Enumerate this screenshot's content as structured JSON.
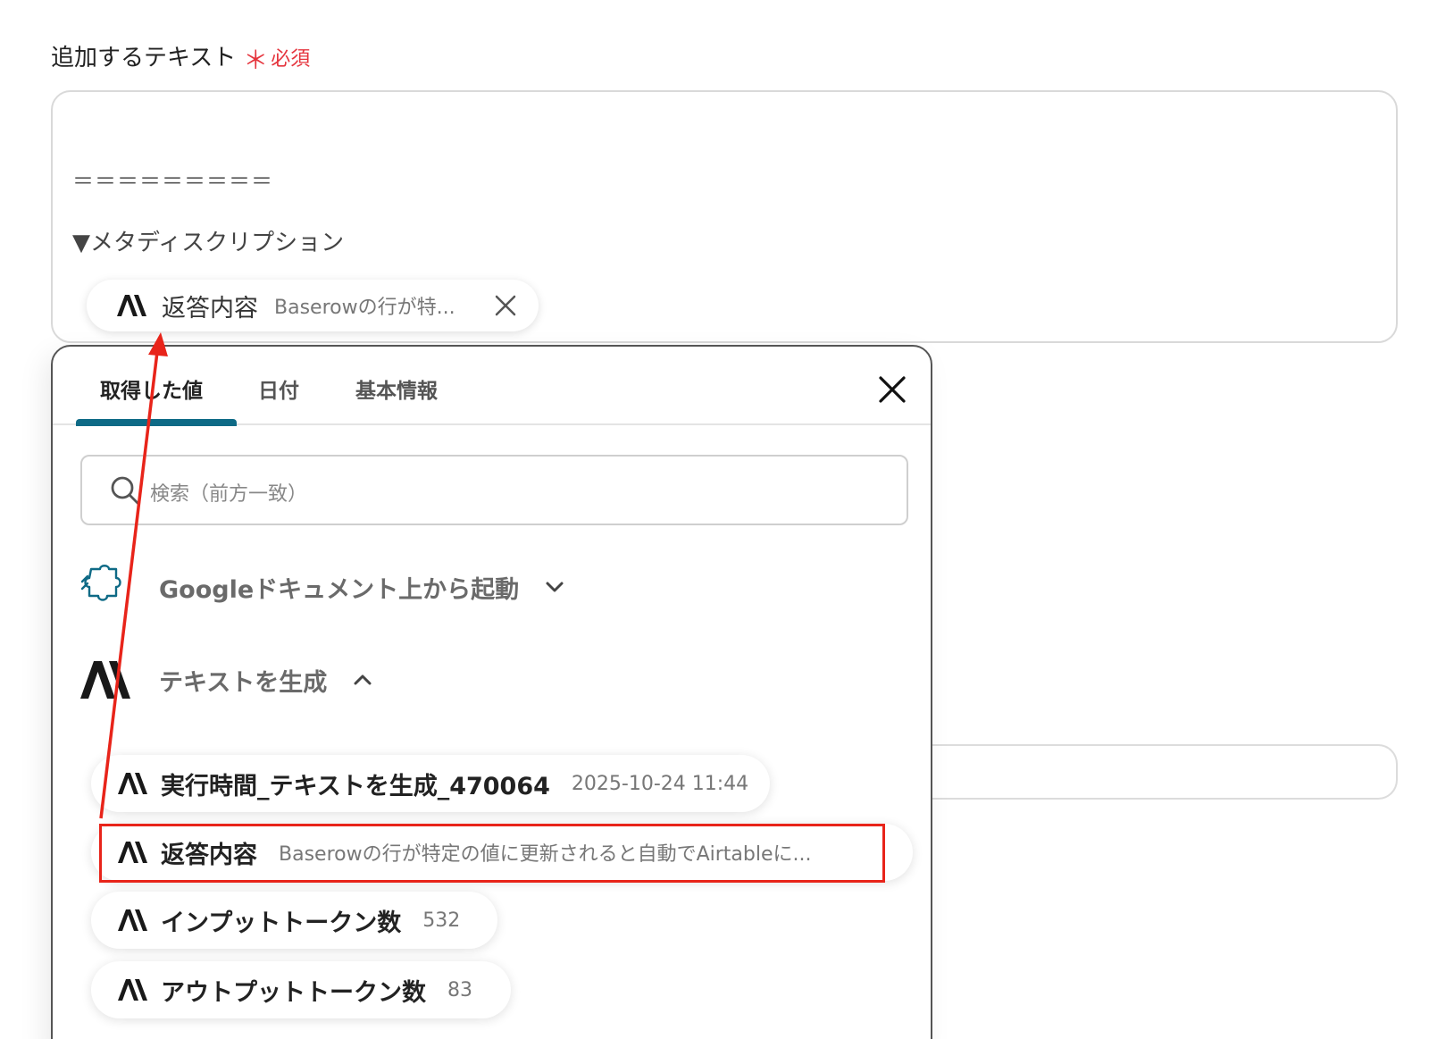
{
  "field": {
    "label": "追加するテキスト",
    "required_mark": "＊",
    "required_label": "必須"
  },
  "textarea": {
    "equals_line": "＝＝＝＝＝＝＝＝＝",
    "meta_heading": "▼メタディスクリプション",
    "chip": {
      "icon": "anthropic-logo-icon",
      "title": "返答内容",
      "value": "Baserowの行が特..."
    }
  },
  "panel": {
    "tabs": [
      {
        "label": "取得した値",
        "active": true
      },
      {
        "label": "日付",
        "active": false
      },
      {
        "label": "基本情報",
        "active": false
      }
    ],
    "search_placeholder": "検索（前方一致）",
    "sections": [
      {
        "title": "Googleドキュメント上から起動",
        "icon": "puzzle-icon",
        "expanded": false
      },
      {
        "title": "テキストを生成",
        "icon": "anthropic-logo-icon",
        "expanded": true
      }
    ],
    "items": [
      {
        "title": "実行時間_テキストを生成_470064",
        "value": "2025-10-24 11:44"
      },
      {
        "title": "返答内容",
        "value": "Baserowの行が特定の値に更新されると自動でAirtableに..."
      },
      {
        "title": "インプットトークン数",
        "value": "532"
      },
      {
        "title": "アウトプットトークン数",
        "value": "83"
      }
    ]
  },
  "colors": {
    "accent": "#0e6a86",
    "required": "#e5343d",
    "annotation": "#e8241a"
  }
}
